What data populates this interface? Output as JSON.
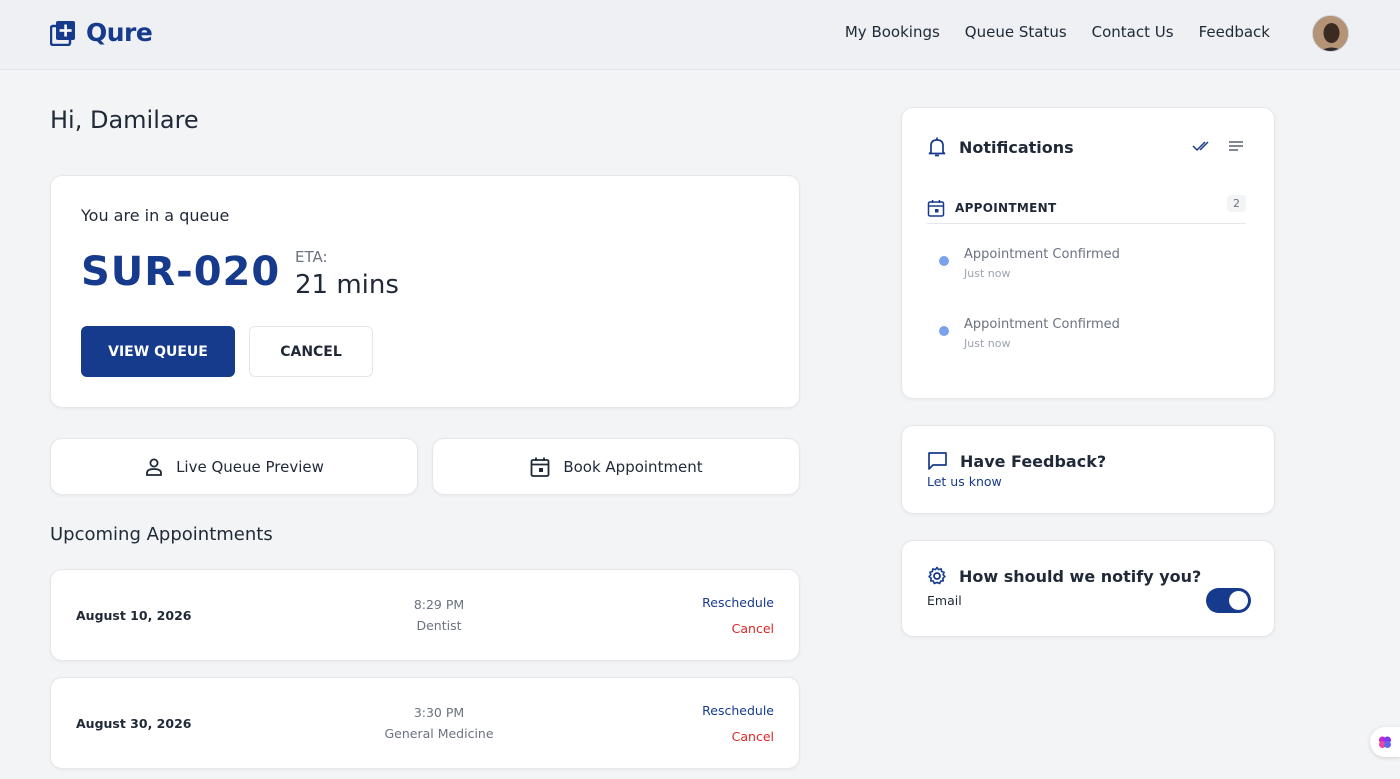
{
  "app": {
    "name": "Qure"
  },
  "nav": {
    "items": [
      "My Bookings",
      "Queue Status",
      "Contact Us",
      "Feedback"
    ]
  },
  "greeting": "Hi, Damilare",
  "queue": {
    "title": "You are in a queue",
    "number": "SUR-020",
    "eta_label": "ETA:",
    "eta_value": "21 mins",
    "view_label": "VIEW QUEUE",
    "cancel_label": "CANCEL"
  },
  "actions": {
    "live_queue": {
      "label": "Live Queue Preview",
      "icon": "person-icon"
    },
    "book": {
      "label": "Book Appointment",
      "icon": "calendar-icon"
    }
  },
  "upcoming": {
    "title": "Upcoming Appointments",
    "items": [
      {
        "date": "August 10, 2026",
        "time": "8:29 PM",
        "department": "Dentist",
        "reschedule": "Reschedule",
        "cancel": "Cancel"
      },
      {
        "date": "August 30, 2026",
        "time": "3:30 PM",
        "department": "General Medicine",
        "reschedule": "Reschedule",
        "cancel": "Cancel"
      }
    ]
  },
  "notifications": {
    "title": "Notifications",
    "category": "APPOINTMENT",
    "count": "2",
    "items": [
      {
        "text": "Appointment Confirmed",
        "time": "Just now"
      },
      {
        "text": "Appointment Confirmed",
        "time": "Just now"
      }
    ]
  },
  "feedback": {
    "title": "Have Feedback?",
    "link": "Let us know"
  },
  "notify": {
    "title": "How should we notify you?",
    "channel": "Email",
    "enabled": true
  },
  "colors": {
    "primary": "#163a8c",
    "danger": "#dc2626",
    "unread_dot": "#7aa2e8"
  }
}
